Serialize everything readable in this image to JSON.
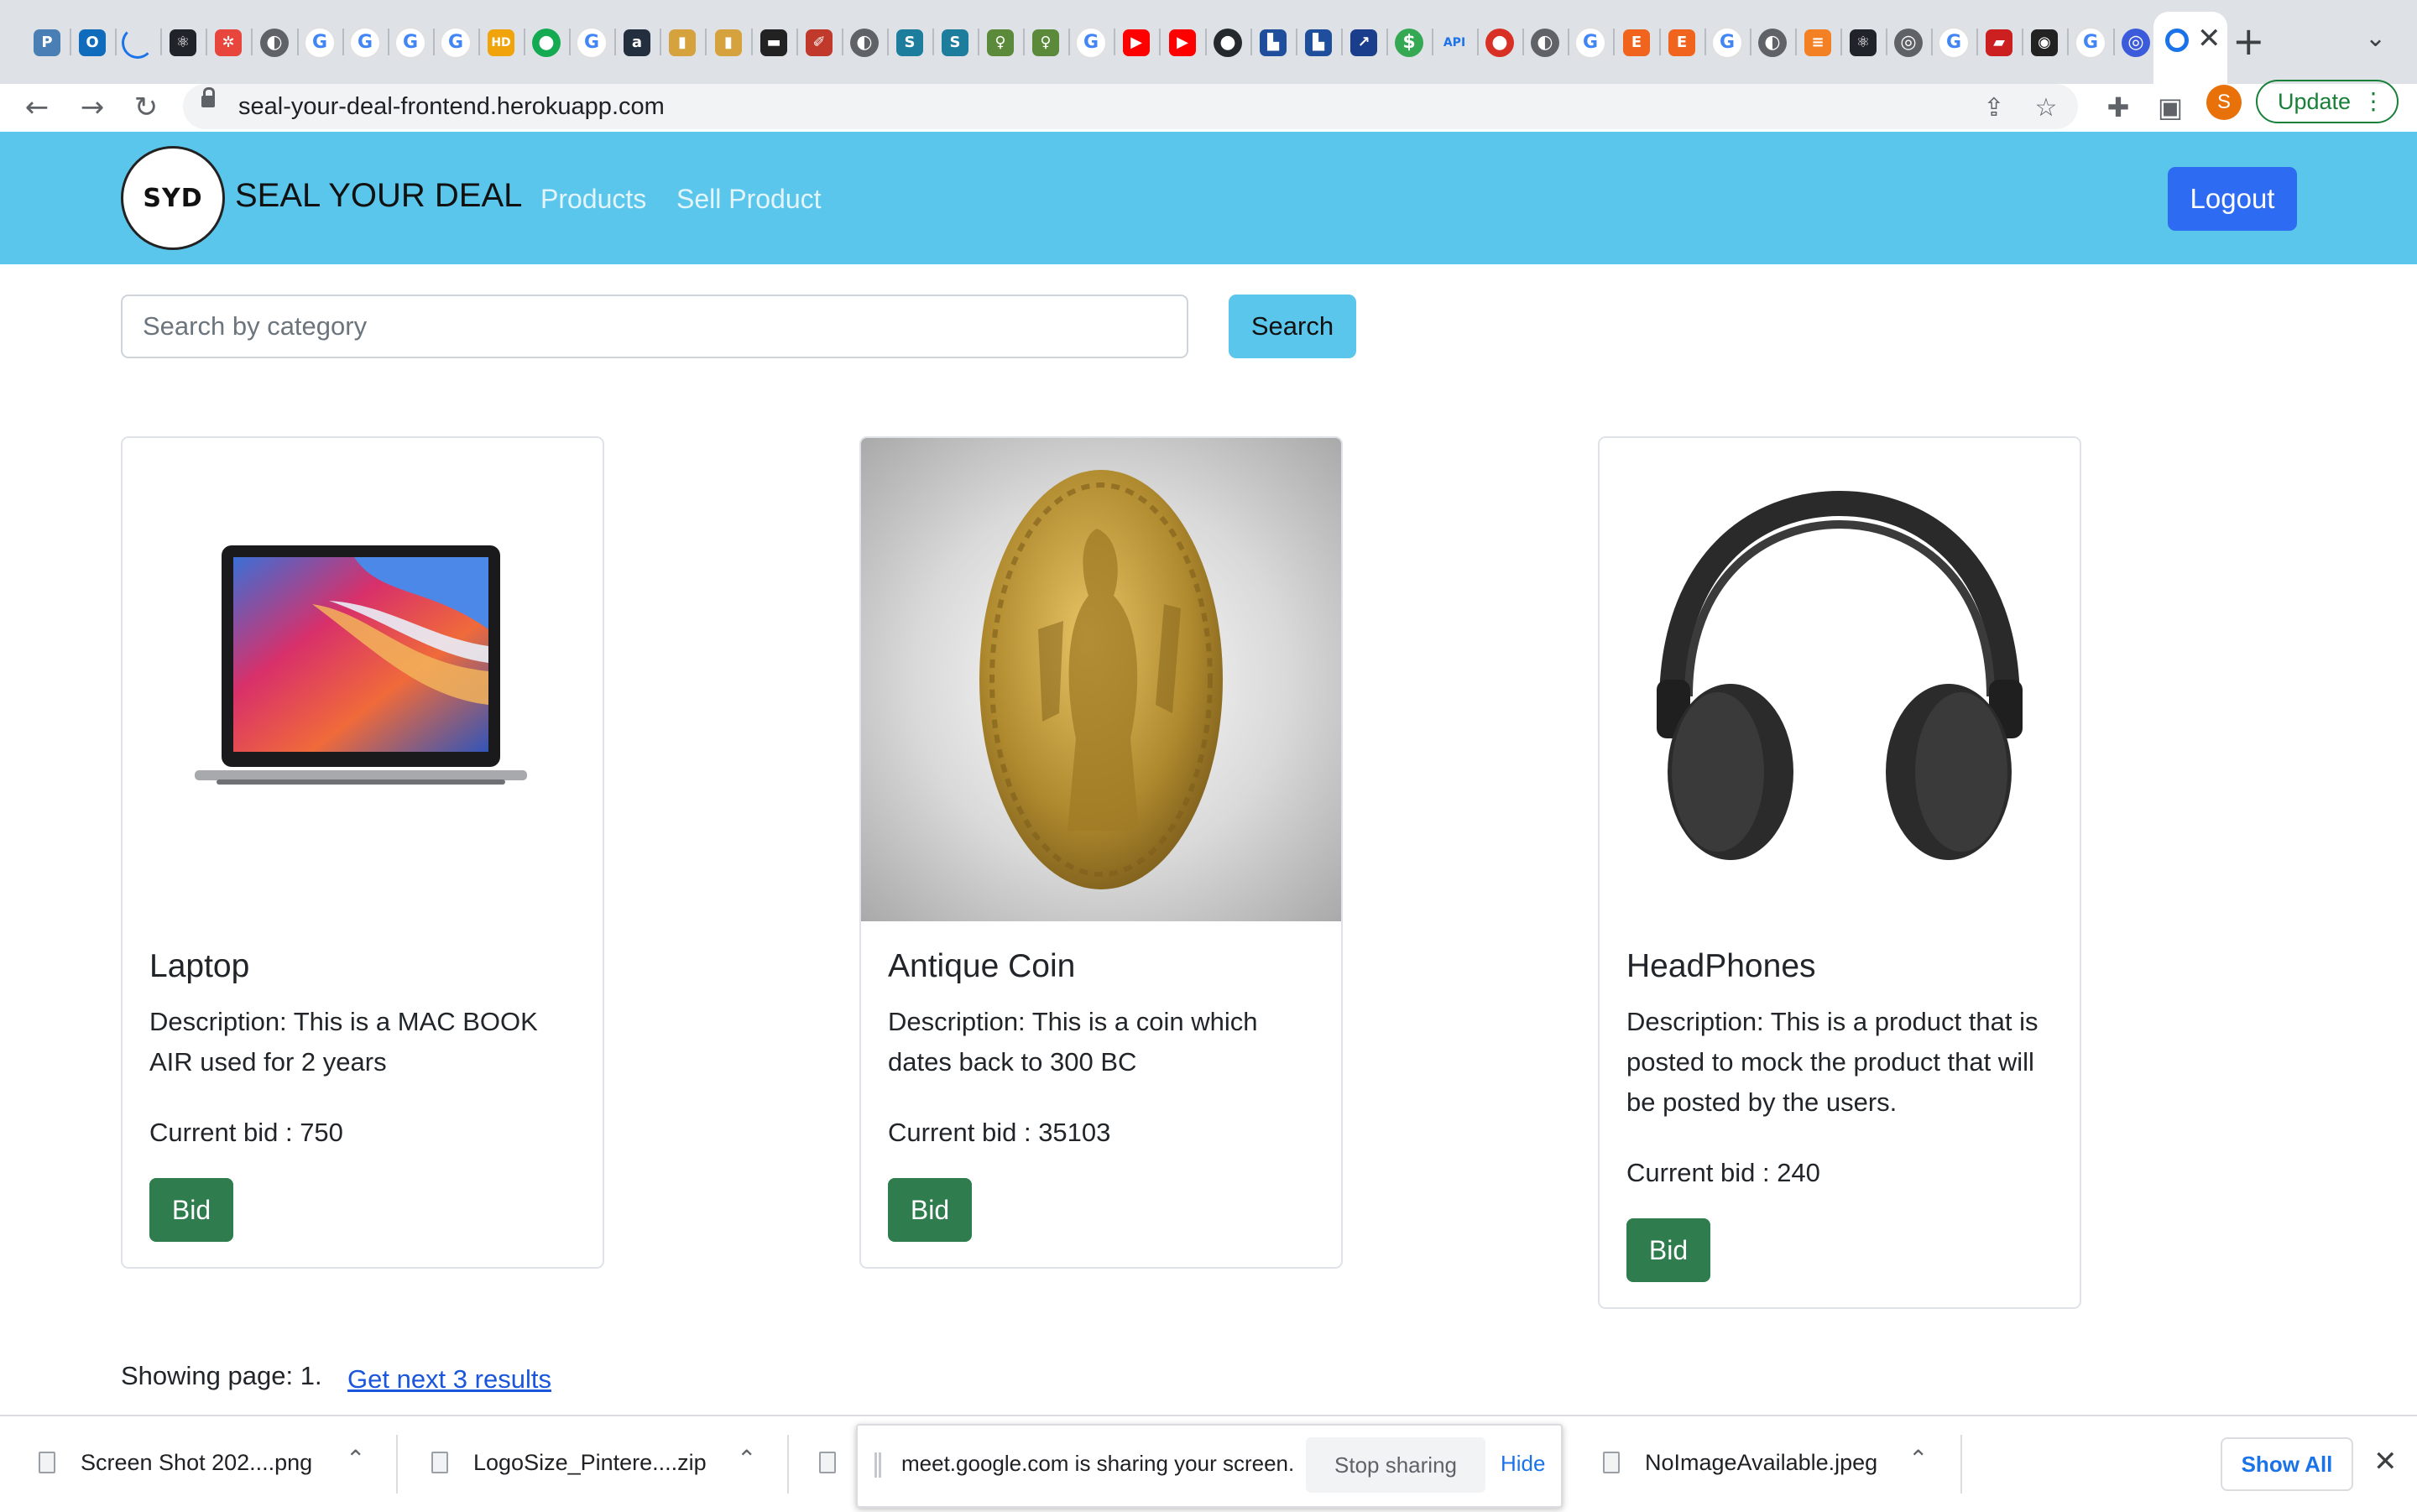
{
  "browser": {
    "tabs_favicons": [
      {
        "name": "pinterest-like-icon",
        "glyph": "P",
        "bg": "#4a7fb5"
      },
      {
        "name": "outlook-icon",
        "glyph": "O",
        "bg": "#0f6cbd"
      },
      {
        "name": "loading-icon",
        "glyph": "",
        "bg": "#dee1e6"
      },
      {
        "name": "react-icon",
        "glyph": "⚛",
        "bg": "#20232a"
      },
      {
        "name": "app-icon",
        "glyph": "✲",
        "bg": "#e8453c"
      },
      {
        "name": "globe-icon",
        "glyph": "◐",
        "bg": "#5f6368"
      },
      {
        "name": "google-icon",
        "glyph": "G",
        "bg": "#4285f4"
      },
      {
        "name": "google-icon",
        "glyph": "G",
        "bg": "#4285f4"
      },
      {
        "name": "google-icon",
        "glyph": "G",
        "bg": "#4285f4"
      },
      {
        "name": "google-icon",
        "glyph": "G",
        "bg": "#4285f4"
      },
      {
        "name": "hd-icon",
        "glyph": "HD",
        "bg": "#f0a30a"
      },
      {
        "name": "mongodb-icon",
        "glyph": "●",
        "bg": "#13aa52"
      },
      {
        "name": "google-icon",
        "glyph": "G",
        "bg": "#4285f4"
      },
      {
        "name": "amazon-icon",
        "glyph": "a",
        "bg": "#232f3e"
      },
      {
        "name": "shopping-bag-icon",
        "glyph": "▮",
        "bg": "#d5a23d"
      },
      {
        "name": "shopping-bag-icon",
        "glyph": "▮",
        "bg": "#d5a23d"
      },
      {
        "name": "briefcase-icon",
        "glyph": "▬",
        "bg": "#222222"
      },
      {
        "name": "feather-icon",
        "glyph": "✐",
        "bg": "#c0392b"
      },
      {
        "name": "globe-icon",
        "glyph": "◐",
        "bg": "#5f6368"
      },
      {
        "name": "stripe-like-icon",
        "glyph": "S",
        "bg": "#1c7d9c"
      },
      {
        "name": "stripe-like-icon",
        "glyph": "S",
        "bg": "#1c7d9c"
      },
      {
        "name": "key-icon",
        "glyph": "♀",
        "bg": "#5b8a3a"
      },
      {
        "name": "key-icon",
        "glyph": "♀",
        "bg": "#5b8a3a"
      },
      {
        "name": "google-icon",
        "glyph": "G",
        "bg": "#4285f4"
      },
      {
        "name": "youtube-icon",
        "glyph": "▶",
        "bg": "#ff0000"
      },
      {
        "name": "youtube-icon",
        "glyph": "▶",
        "bg": "#ff0000"
      },
      {
        "name": "github-icon",
        "glyph": "●",
        "bg": "#24292e"
      },
      {
        "name": "chart-icon",
        "glyph": "▙",
        "bg": "#1f4e9c"
      },
      {
        "name": "chart-icon",
        "glyph": "▙",
        "bg": "#1f4e9c"
      },
      {
        "name": "arrow-icon",
        "glyph": "↗",
        "bg": "#1a3e8c"
      },
      {
        "name": "dollar-icon",
        "glyph": "$",
        "bg": "#34a853"
      },
      {
        "name": "api-icon",
        "glyph": "API",
        "bg": "#dee1e6"
      },
      {
        "name": "record-icon",
        "glyph": "●",
        "bg": "#d93025"
      },
      {
        "name": "globe-icon",
        "glyph": "◐",
        "bg": "#5f6368"
      },
      {
        "name": "google-icon",
        "glyph": "G",
        "bg": "#4285f4"
      },
      {
        "name": "etsy-icon",
        "glyph": "E",
        "bg": "#f1641e"
      },
      {
        "name": "etsy-icon",
        "glyph": "E",
        "bg": "#f1641e"
      },
      {
        "name": "google-icon",
        "glyph": "G",
        "bg": "#4285f4"
      },
      {
        "name": "globe-icon",
        "glyph": "◐",
        "bg": "#5f6368"
      },
      {
        "name": "stackoverflow-icon",
        "glyph": "≡",
        "bg": "#f48024"
      },
      {
        "name": "react-icon",
        "glyph": "⚛",
        "bg": "#20232a"
      },
      {
        "name": "chrome-icon",
        "glyph": "◎",
        "bg": "#5f6368"
      },
      {
        "name": "google-icon",
        "glyph": "G",
        "bg": "#4285f4"
      },
      {
        "name": "red-app-icon",
        "glyph": "▰",
        "bg": "#cc1f1f"
      },
      {
        "name": "cat-icon",
        "glyph": "◉",
        "bg": "#222222"
      },
      {
        "name": "google-icon",
        "glyph": "G",
        "bg": "#4285f4"
      },
      {
        "name": "circle-app-icon",
        "glyph": "◎",
        "bg": "#3b5bdb"
      }
    ],
    "url": "seal-your-deal-frontend.herokuapp.com",
    "update_label": "Update",
    "profile_initial": "S"
  },
  "header": {
    "logo_text": "SYD",
    "brand": "SEAL YOUR DEAL",
    "nav": [
      "Products",
      "Sell Product"
    ],
    "logout_label": "Logout"
  },
  "search": {
    "placeholder": "Search by category",
    "value": "",
    "button_label": "Search"
  },
  "products": [
    {
      "title": "Laptop",
      "description": "Description: This is a MAC BOOK AIR used for 2 years",
      "bid_text": "Current bid : 750",
      "bid_label": "Bid",
      "image": "laptop-image"
    },
    {
      "title": "Antique Coin",
      "description": "Description: This is a coin which dates back to 300 BC",
      "bid_text": "Current bid : 35103",
      "bid_label": "Bid",
      "image": "coin-image"
    },
    {
      "title": "HeadPhones",
      "description": "Description: This is a product that is posted to mock the product that will be posted by the users.",
      "bid_text": "Current bid : 240",
      "bid_label": "Bid",
      "image": "headphones-image"
    }
  ],
  "pagination": {
    "text": "Showing page: 1.",
    "next_label": "Get next 3 results"
  },
  "downloads": {
    "items": [
      "Screen Shot 202....png",
      "LogoSize_Pintere....zip",
      "",
      "NoImageAvailable.jpeg"
    ],
    "show_all_label": "Show All"
  },
  "screen_share": {
    "message": "meet.google.com is sharing your screen.",
    "stop_label": "Stop sharing",
    "hide_label": "Hide"
  },
  "colors": {
    "header_bg": "#5bc6eb",
    "logout_bg": "#2d6cf2",
    "bid_bg": "#2f7d4f",
    "link": "#1a56db"
  }
}
